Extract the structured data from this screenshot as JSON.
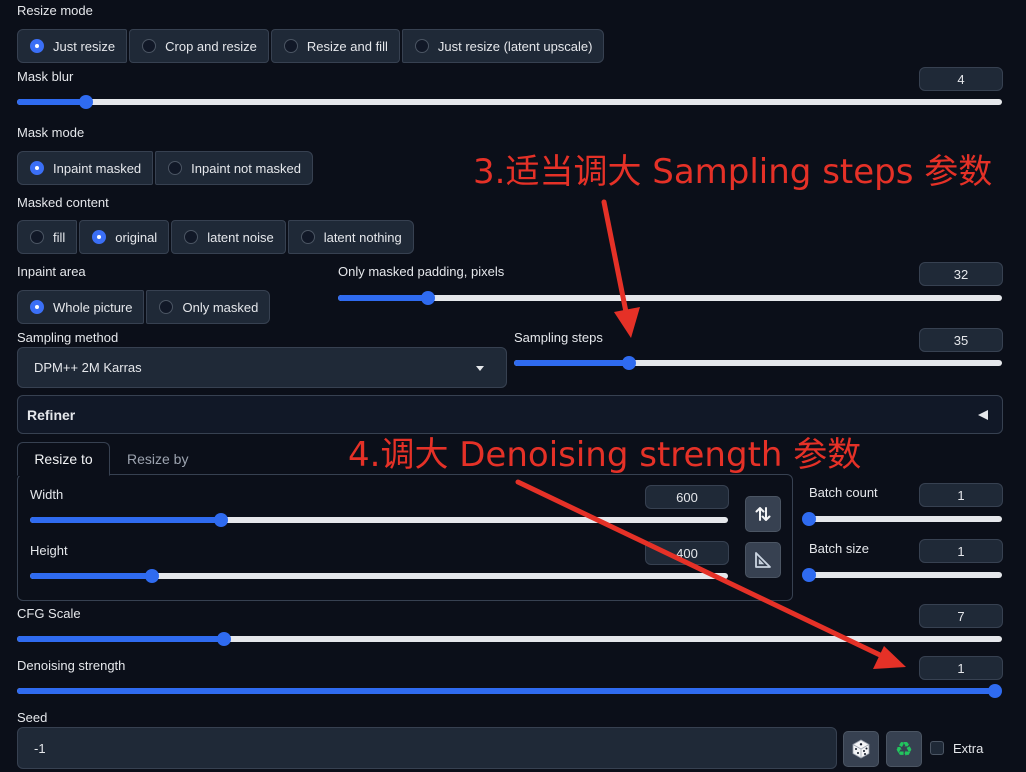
{
  "resize_mode": {
    "label": "Resize mode",
    "options": [
      "Just resize",
      "Crop and resize",
      "Resize and fill",
      "Just resize (latent upscale)"
    ],
    "selected": "Just resize"
  },
  "mask_blur": {
    "label": "Mask blur",
    "value": "4",
    "fraction": 0.07
  },
  "mask_mode": {
    "label": "Mask mode",
    "options": [
      "Inpaint masked",
      "Inpaint not masked"
    ],
    "selected": "Inpaint masked"
  },
  "masked_content": {
    "label": "Masked content",
    "options": [
      "fill",
      "original",
      "latent noise",
      "latent nothing"
    ],
    "selected": "original"
  },
  "inpaint_area": {
    "label": "Inpaint area",
    "options": [
      "Whole picture",
      "Only masked"
    ],
    "selected": "Whole picture"
  },
  "only_masked_padding": {
    "label": "Only masked padding, pixels",
    "value": "32",
    "fraction": 0.135
  },
  "sampling_method": {
    "label": "Sampling method",
    "value": "DPM++ 2M Karras"
  },
  "sampling_steps": {
    "label": "Sampling steps",
    "value": "35",
    "fraction": 0.235
  },
  "refiner": {
    "label": "Refiner"
  },
  "resize_tabs": {
    "tabs": [
      "Resize to",
      "Resize by"
    ],
    "active": "Resize to"
  },
  "width": {
    "label": "Width",
    "value": "600",
    "fraction": 0.273
  },
  "height": {
    "label": "Height",
    "value": "400",
    "fraction": 0.175
  },
  "batch_count": {
    "label": "Batch count",
    "value": "1",
    "fraction": 0.0
  },
  "batch_size": {
    "label": "Batch size",
    "value": "1",
    "fraction": 0.0
  },
  "cfg_scale": {
    "label": "CFG Scale",
    "value": "7",
    "fraction": 0.21
  },
  "denoising_strength": {
    "label": "Denoising strength",
    "value": "1",
    "fraction": 1.0
  },
  "seed": {
    "label": "Seed",
    "value": "-1",
    "extra_label": "Extra"
  },
  "annotations": {
    "step3": "3.适当调大 Sampling steps 参数",
    "step4": "4.调大 Denoising strength 参数"
  },
  "icons": {
    "swap": "swap-arrows-icon",
    "aspect": "triangle-ruler-icon",
    "dice": "dice-icon",
    "recycle": "recycle-icon"
  },
  "colors": {
    "accent": "#2f6bf0",
    "annotation": "#e53127",
    "background": "#0b0f19"
  }
}
